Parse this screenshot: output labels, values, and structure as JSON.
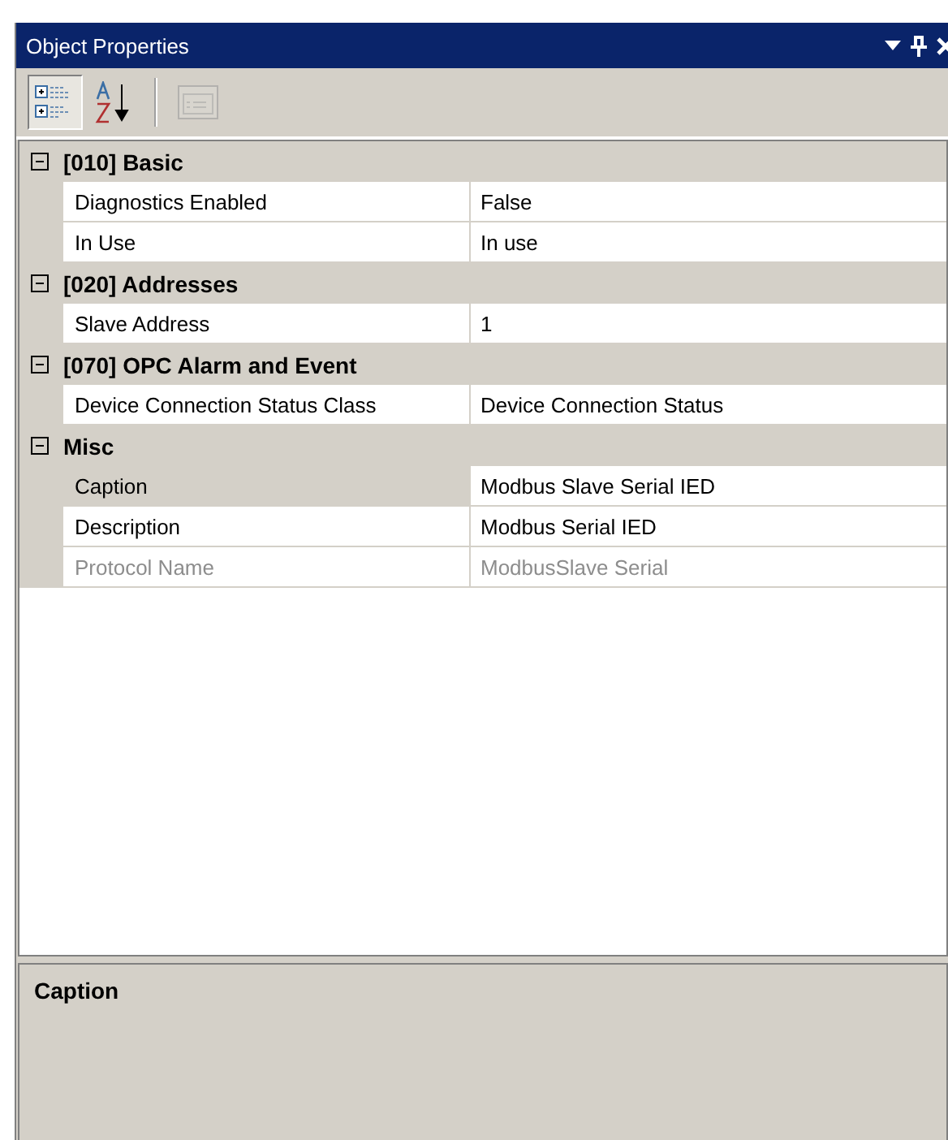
{
  "window": {
    "title": "Object Properties"
  },
  "toolbar": [
    {
      "kind": "categorized",
      "selected": true,
      "disabled": false
    },
    {
      "kind": "alphabetical",
      "selected": false,
      "disabled": false
    },
    {
      "kind": "pages",
      "selected": false,
      "disabled": true
    }
  ],
  "groups": [
    {
      "title": "[010] Basic",
      "expanded": true,
      "rows": [
        {
          "name": "Diagnostics Enabled",
          "value": "False",
          "selected": false,
          "disabled": false
        },
        {
          "name": "In Use",
          "value": "In use",
          "selected": false,
          "disabled": false
        }
      ]
    },
    {
      "title": "[020] Addresses",
      "expanded": true,
      "rows": [
        {
          "name": "Slave Address",
          "value": "1",
          "selected": false,
          "disabled": false
        }
      ]
    },
    {
      "title": "[070] OPC Alarm and Event",
      "expanded": true,
      "rows": [
        {
          "name": "Device Connection Status Class",
          "value": "Device Connection Status",
          "selected": false,
          "disabled": false
        }
      ]
    },
    {
      "title": "Misc",
      "expanded": true,
      "rows": [
        {
          "name": "Caption",
          "value": "Modbus Slave Serial IED",
          "selected": true,
          "disabled": false
        },
        {
          "name": "Description",
          "value": "Modbus Serial IED",
          "selected": false,
          "disabled": false
        },
        {
          "name": "Protocol Name",
          "value": "ModbusSlave Serial",
          "selected": false,
          "disabled": true
        }
      ]
    }
  ],
  "description": {
    "title": "Caption"
  }
}
